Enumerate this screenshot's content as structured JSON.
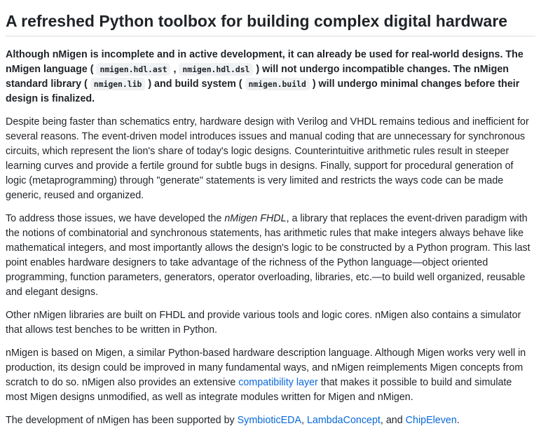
{
  "heading": "A refreshed Python toolbox for building complex digital hardware",
  "lead": {
    "t1": "Although nMigen is incomplete and in active development, it can already be used for real-world designs. The nMigen language ( ",
    "code1": "nmigen.hdl.ast",
    "t2": " , ",
    "code2": "nmigen.hdl.dsl",
    "t3": " ) will not undergo incompatible changes. The nMigen standard library ( ",
    "code3": "nmigen.lib",
    "t4": " ) and build system ( ",
    "code4": "nmigen.build",
    "t5": " ) will undergo minimal changes before their design is finalized."
  },
  "para2": "Despite being faster than schematics entry, hardware design with Verilog and VHDL remains tedious and inefficient for several reasons. The event-driven model introduces issues and manual coding that are unnecessary for synchronous circuits, which represent the lion's share of today's logic designs. Counterintuitive arithmetic rules result in steeper learning curves and provide a fertile ground for subtle bugs in designs. Finally, support for procedural generation of logic (metaprogramming) through \"generate\" statements is very limited and restricts the ways code can be made generic, reused and organized.",
  "para3": {
    "t1": "To address those issues, we have developed the ",
    "em": "nMigen FHDL",
    "t2": ", a library that replaces the event-driven paradigm with the notions of combinatorial and synchronous statements, has arithmetic rules that make integers always behave like mathematical integers, and most importantly allows the design's logic to be constructed by a Python program. This last point enables hardware designers to take advantage of the richness of the Python language—object oriented programming, function parameters, generators, operator overloading, libraries, etc.—to build well organized, reusable and elegant designs."
  },
  "para4": "Other nMigen libraries are built on FHDL and provide various tools and logic cores. nMigen also contains a simulator that allows test benches to be written in Python.",
  "para5": {
    "t1": "nMigen is based on Migen, a similar Python-based hardware description language. Although Migen works very well in production, its design could be improved in many fundamental ways, and nMigen reimplements Migen concepts from scratch to do so. nMigen also provides an extensive ",
    "link": "compatibility layer",
    "t2": " that makes it possible to build and simulate most Migen designs unmodified, as well as integrate modules written for Migen and nMigen."
  },
  "para6": {
    "t1": "The development of nMigen has been supported by ",
    "link1": "SymbioticEDA",
    "sep1": ", ",
    "link2": "LambdaConcept",
    "sep2": ", and ",
    "link3": "ChipEleven",
    "end": "."
  }
}
